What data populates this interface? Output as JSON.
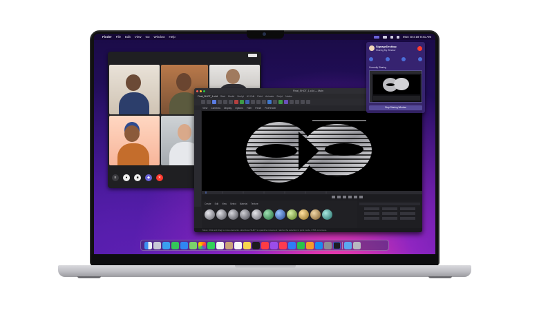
{
  "menubar": {
    "app_name": "Finder",
    "items": [
      "File",
      "Edit",
      "View",
      "Go",
      "Window",
      "Help"
    ],
    "datetime": "Mon Oct 18 9:41 AM"
  },
  "share_panel": {
    "title": "SignageDesktop",
    "subtitle": "Sharing My Window",
    "section_label": "Currently Sharing",
    "button_label": "Stop Sharing Window"
  },
  "cinema": {
    "title": "Final_SHOT_1.c4d — Main",
    "tabs": [
      "Final_SHOT_1.c4d",
      "Start",
      "Model",
      "Sculpt",
      "UV Edit",
      "Paint",
      "Animate",
      "Script",
      "Nodes"
    ],
    "menu": [
      "View",
      "Cameras",
      "Display",
      "Options",
      "Filter",
      "Panel",
      "ProRender"
    ],
    "materials_menu": [
      "Create",
      "Edit",
      "View",
      "Select",
      "Material",
      "Texture"
    ],
    "status": "Move: Click and drag to move elements. Hold down SHIFT to quantize movement / add to the selection in point mode, CTRL to remove."
  },
  "colors": {
    "close": "#ff3b30",
    "minimize": "#ffbd2e",
    "zoom": "#28c840",
    "accent": "#4b6ed8"
  },
  "icons": {
    "apple": "apple-icon",
    "wifi": "wifi-icon",
    "battery": "battery-icon",
    "end_call": "end-call-icon"
  }
}
